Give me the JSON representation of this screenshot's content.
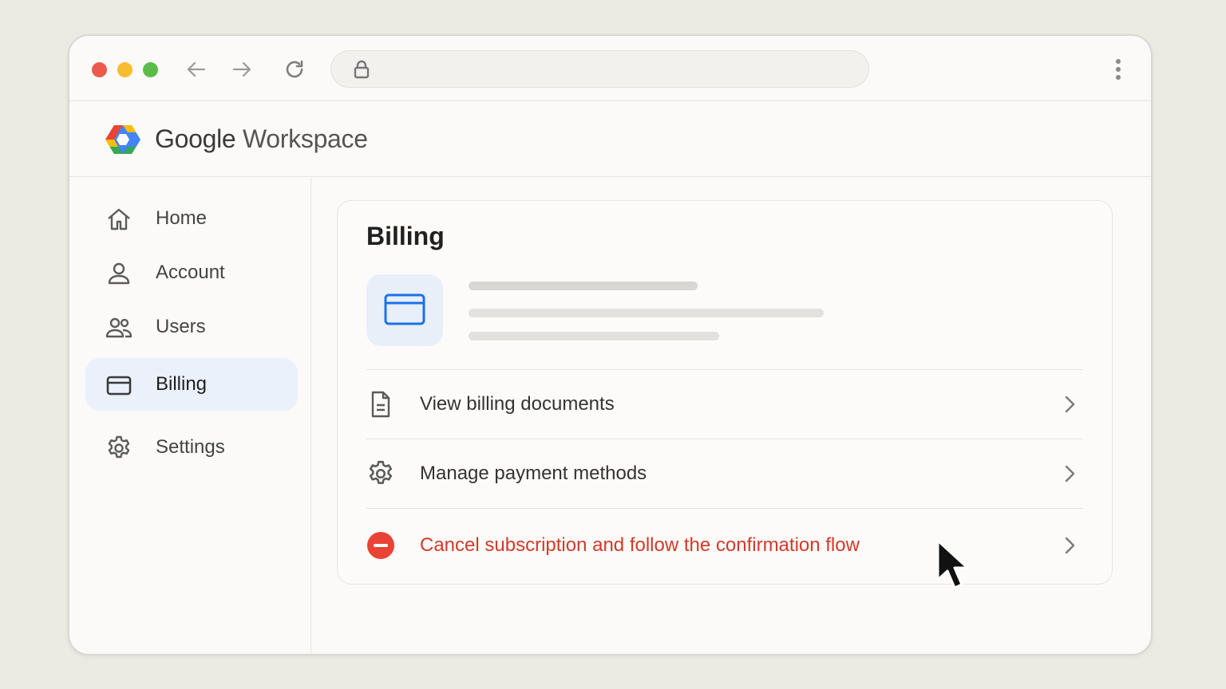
{
  "browser": {
    "back_icon": "arrow-left-icon",
    "forward_icon": "arrow-right-icon",
    "reload_icon": "reload-icon",
    "lock_icon": "lock-icon",
    "address_value": "",
    "menu_icon": "kebab-menu-icon"
  },
  "header": {
    "brand_primary": "Google",
    "brand_secondary": "Workspace"
  },
  "sidebar": {
    "items": [
      {
        "label": "Home",
        "icon": "home-icon",
        "active": false
      },
      {
        "label": "Account",
        "icon": "person-icon",
        "active": false
      },
      {
        "label": "Users",
        "icon": "users-icon",
        "active": false
      },
      {
        "label": "Billing",
        "icon": "credit-card-icon",
        "active": true
      },
      {
        "label": "Settings",
        "icon": "gear-icon",
        "active": false
      }
    ]
  },
  "main": {
    "title": "Billing",
    "hero_icon": "credit-card-icon",
    "rows": [
      {
        "label": "View billing documents",
        "icon": "document-icon"
      },
      {
        "label": "Manage payment methods",
        "icon": "gear-icon"
      },
      {
        "label": "Cancel subscription and follow the confirmation flow",
        "icon": "minus-circle-icon",
        "danger": true
      }
    ]
  },
  "colors": {
    "accent": "#1a73e8",
    "active_nav_bg": "#eaf1fb",
    "danger": "#d23a2a"
  }
}
